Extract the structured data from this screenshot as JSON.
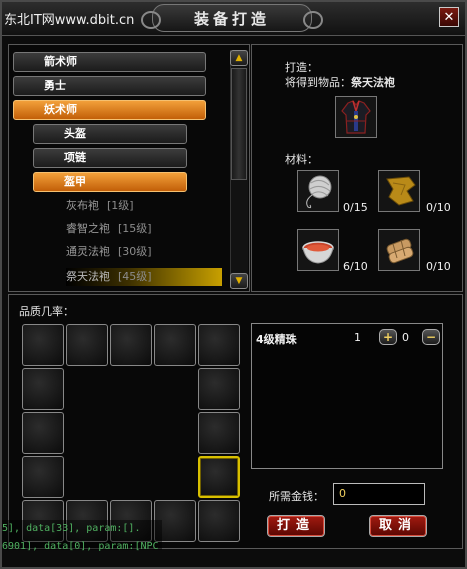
{
  "title": "装备打造",
  "watermark": "东北IT网www.dbit.cn",
  "close_symbol": "✕",
  "tree": {
    "categories": [
      {
        "label": "箭术师"
      },
      {
        "label": "勇士"
      },
      {
        "label": "妖术师"
      }
    ],
    "subcategories": [
      {
        "label": "头盔"
      },
      {
        "label": "项链"
      },
      {
        "label": "盔甲"
      }
    ],
    "items": [
      {
        "name": "灰布袍",
        "level": "[1级]"
      },
      {
        "name": "睿智之袍",
        "level": "[15级]"
      },
      {
        "name": "通灵法袍",
        "level": "[30级]"
      },
      {
        "name": "祭天法袍",
        "level": "[45级]"
      }
    ],
    "scroll_up": "▲",
    "scroll_down": "▼"
  },
  "craft": {
    "heading": "打造：",
    "result_prefix": "将得到物品：",
    "result_item": "祭天法袍",
    "materials_label": "材料：",
    "materials": [
      {
        "icon": "thread-ball-icon",
        "qty": "0/15"
      },
      {
        "icon": "leather-scrap-icon",
        "qty": "0/10"
      },
      {
        "icon": "dye-bowl-icon",
        "qty": "6/10"
      },
      {
        "icon": "cloth-bundle-icon",
        "qty": "0/10"
      }
    ]
  },
  "quality": {
    "label": "品质几率：",
    "entry_name": "4级精珠",
    "entry_count": "1",
    "plus": "+",
    "entry_value": "0",
    "minus": "−"
  },
  "money": {
    "label": "所需金钱：",
    "value": "0"
  },
  "buttons": {
    "craft": "打造",
    "cancel": "取消"
  },
  "log": {
    "line1": "5], data[33], param:[].",
    "line2": "6901], data[0], param:[NPC"
  },
  "colors": {
    "accent_orange": "#e07a10",
    "highlight_yellow": "#d8c000",
    "button_red": "#a21a10"
  }
}
